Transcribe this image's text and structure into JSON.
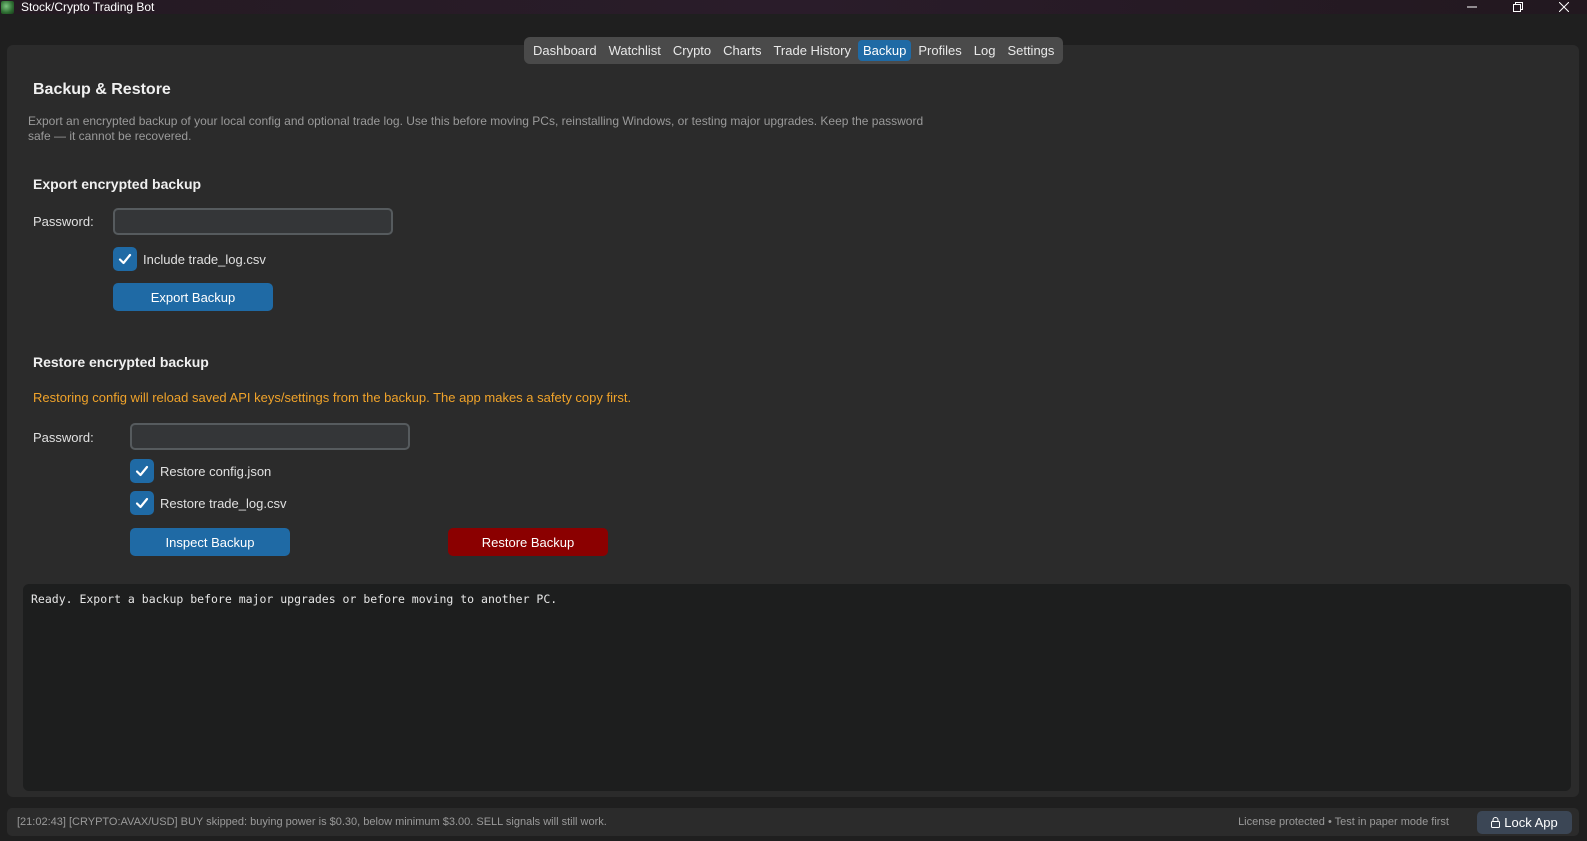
{
  "window": {
    "title": "Stock/Crypto Trading Bot"
  },
  "tabs": [
    {
      "label": "Dashboard"
    },
    {
      "label": "Watchlist"
    },
    {
      "label": "Crypto"
    },
    {
      "label": "Charts"
    },
    {
      "label": "Trade History"
    },
    {
      "label": "Backup",
      "active": true
    },
    {
      "label": "Profiles"
    },
    {
      "label": "Log"
    },
    {
      "label": "Settings"
    }
  ],
  "page": {
    "title": "Backup & Restore",
    "description": "Export an encrypted backup of your local config and optional trade log. Use this before moving PCs, reinstalling Windows, or testing major upgrades. Keep the password safe — it cannot be recovered."
  },
  "export": {
    "heading": "Export encrypted backup",
    "password_label": "Password:",
    "password_value": "",
    "include_trade_log_label": "Include trade_log.csv",
    "include_trade_log_checked": true,
    "export_button": "Export Backup"
  },
  "restore": {
    "heading": "Restore encrypted backup",
    "warning": "Restoring config will reload saved API keys/settings from the backup. The app makes a safety copy first.",
    "password_label": "Password:",
    "password_value": "",
    "restore_config_label": "Restore config.json",
    "restore_config_checked": true,
    "restore_trade_log_label": "Restore trade_log.csv",
    "restore_trade_log_checked": true,
    "inspect_button": "Inspect Backup",
    "restore_button": "Restore Backup"
  },
  "console": {
    "text": "Ready. Export a backup before major upgrades or before moving to another PC."
  },
  "statusbar": {
    "message": "[21:02:43] [CRYPTO:AVAX/USD] BUY skipped: buying power is $0.30, below minimum $3.00. SELL signals will still work.",
    "license": "License protected • Test in paper mode first",
    "lock_button": "Lock App"
  },
  "colors": {
    "accent": "#1f6aa5",
    "danger": "#8b0000",
    "warning": "#f0a32a",
    "background": "#2b2b2b"
  },
  "icons": {
    "app": "app-logo-icon",
    "minimize": "minimize-icon",
    "restore": "restore-window-icon",
    "close": "close-icon",
    "check": "checkmark-icon",
    "lock": "lock-icon"
  }
}
